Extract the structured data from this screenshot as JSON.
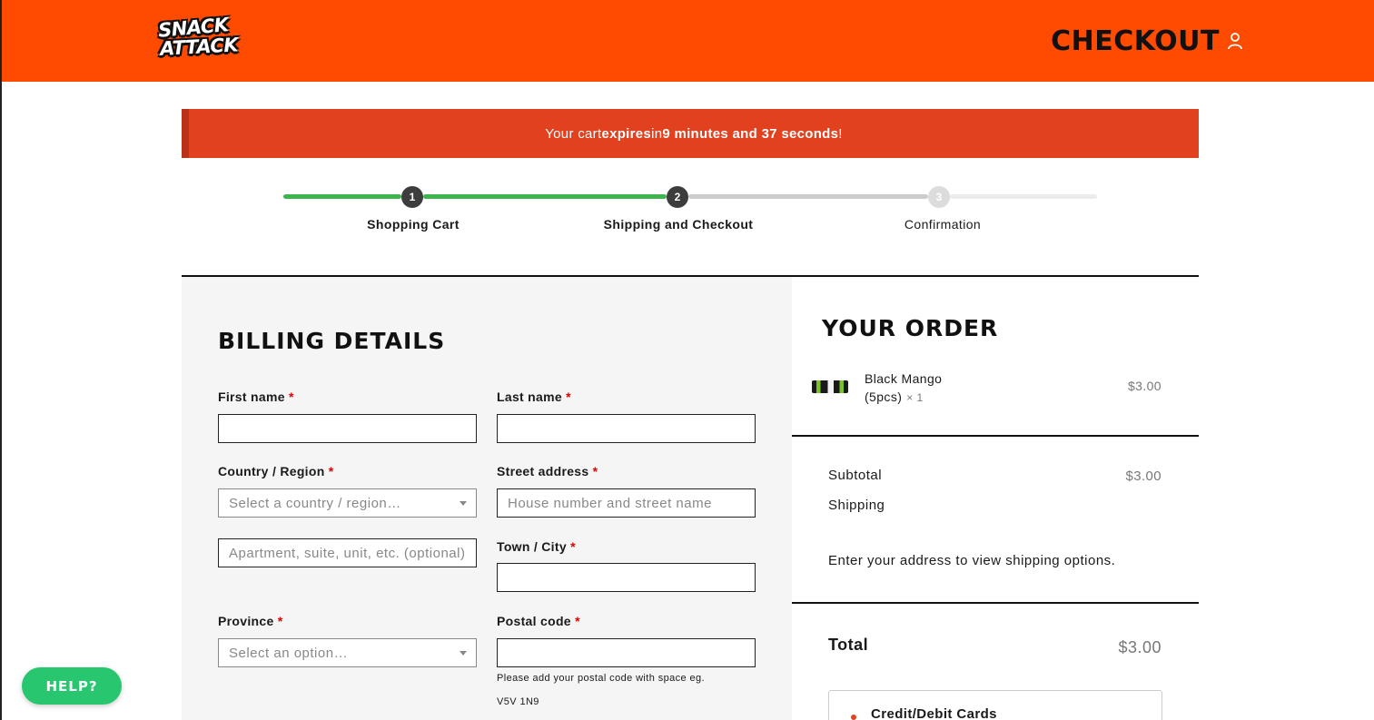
{
  "header": {
    "logo_line1": "SNACK",
    "logo_line2": "ATTACK",
    "title": "CHECKOUT",
    "brand_color": "#ff4b00",
    "user_icon": "user-icon"
  },
  "timer": {
    "prefix": "Your cart ",
    "expires": "expires",
    "middle": " in ",
    "countdown": "9 minutes and 37 seconds",
    "suffix": "!"
  },
  "progress": {
    "steps": [
      {
        "number": "1",
        "label": "Shopping Cart",
        "state": "complete"
      },
      {
        "number": "2",
        "label": "Shipping and Checkout",
        "state": "current"
      },
      {
        "number": "3",
        "label": "Confirmation",
        "state": "upcoming"
      }
    ],
    "complete_color": "#3cb54a"
  },
  "billing": {
    "title": "BILLING DETAILS",
    "required_mark": "*",
    "fields": {
      "first_name": {
        "label": "First name",
        "value": ""
      },
      "last_name": {
        "label": "Last name",
        "value": ""
      },
      "country": {
        "label": "Country / Region",
        "placeholder": "Select a country / region…"
      },
      "street": {
        "label": "Street address",
        "placeholder": "House number and street name"
      },
      "apartment": {
        "placeholder": "Apartment, suite, unit, etc. (optional)"
      },
      "town": {
        "label": "Town / City",
        "value": ""
      },
      "province": {
        "label": "Province",
        "placeholder": "Select an option…"
      },
      "postal": {
        "label": "Postal code",
        "value": "",
        "hint_line1": "Please add your postal code with space eg.",
        "hint_line2": "V5V 1N9"
      }
    }
  },
  "order": {
    "title": "YOUR ORDER",
    "items": [
      {
        "name_line1": "Black Mango",
        "name_line2": "(5pcs)",
        "qty": "× 1",
        "price": "$3.00"
      }
    ],
    "subtotal_label": "Subtotal",
    "subtotal_value": "$3.00",
    "shipping_label": "Shipping",
    "shipping_note": "Enter your address to view shipping options.",
    "total_label": "Total",
    "total_value": "$3.00",
    "payment_method": "Credit/Debit Cards"
  },
  "help": {
    "label": "HELP?",
    "color": "#28c76f"
  }
}
